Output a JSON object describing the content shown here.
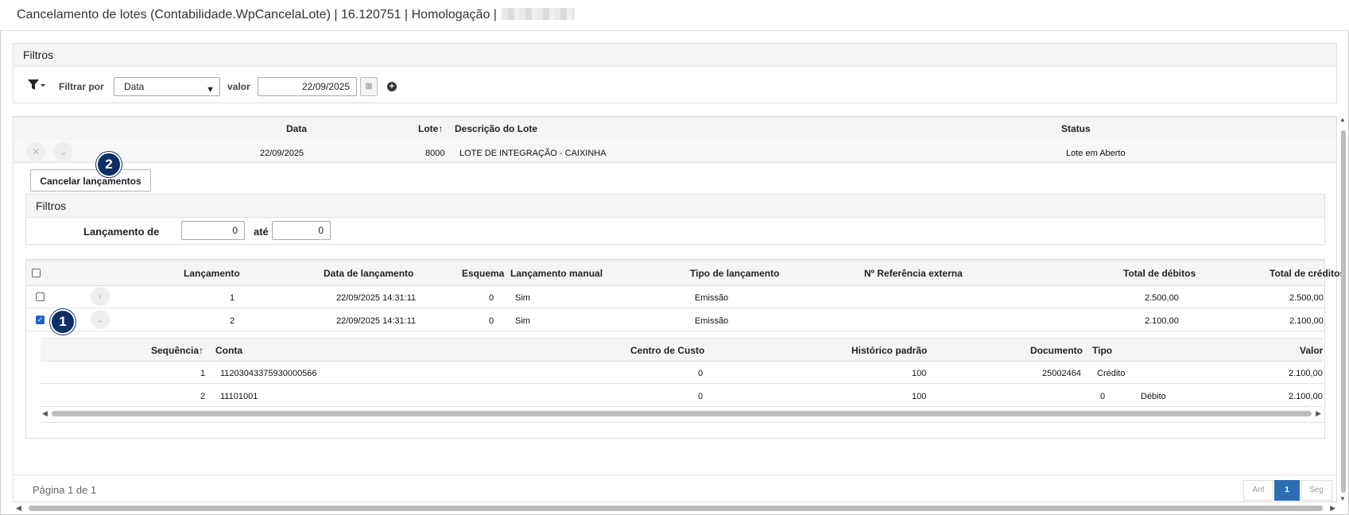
{
  "window": {
    "title": "Cancelamento de lotes (Contabilidade.WpCancelaLote) | 16.120751 | Homologação |"
  },
  "filters": {
    "header": "Filtros",
    "filter_by_label": "Filtrar por",
    "filter_field": "Data",
    "value_label": "valor",
    "value": "22/09/2025"
  },
  "lots_grid": {
    "columns": [
      "Data",
      "Lote",
      "Descrição do Lote",
      "Status"
    ],
    "sort_icon": "↑",
    "row": {
      "data": "22/09/2025",
      "lote": "8000",
      "descricao": "LOTE DE INTEGRAÇÃO - CAIXINHA",
      "status": "Lote em Aberto"
    }
  },
  "actions": {
    "cancel_button": "Cancelar lançamentos",
    "badge_2": "2",
    "badge_1": "1"
  },
  "sub_filters": {
    "header": "Filtros",
    "from_label": "Lançamento de",
    "from_value": "0",
    "to_label": "até",
    "to_value": "0"
  },
  "entries_grid": {
    "columns": [
      "Lançamento",
      "Data de lançamento",
      "Esquema",
      "Lançamento manual",
      "Tipo de lançamento",
      "Nº Referência externa",
      "Total de débitos",
      "Total de créditos"
    ],
    "rows": [
      {
        "lancamento": "1",
        "data": "22/09/2025 14:31:11",
        "esquema": "0",
        "manual": "Sim",
        "tipo": "Emissão",
        "ref": "",
        "debitos": "2.500,00",
        "creditos": "2.500,00",
        "checked": false
      },
      {
        "lancamento": "2",
        "data": "22/09/2025 14:31:11",
        "esquema": "0",
        "manual": "Sim",
        "tipo": "Emissão",
        "ref": "",
        "debitos": "2.100,00",
        "creditos": "2.100,00",
        "checked": true
      }
    ]
  },
  "detail_grid": {
    "columns": [
      "Sequência",
      "Conta",
      "Centro de Custo",
      "Histórico padrão",
      "Documento",
      "Tipo",
      "Valor"
    ],
    "rows": [
      {
        "seq": "1",
        "conta": "11203043375930000566",
        "centro": "0",
        "historico": "100",
        "documento": "25002464",
        "tipo": "Crédito",
        "valor": "2.100,00"
      },
      {
        "seq": "2",
        "conta": "11101001",
        "centro": "0",
        "historico": "100",
        "documento": "0",
        "tipo": "Débito",
        "valor": "2.100,00"
      }
    ]
  },
  "pagination": {
    "label": "Página 1 de 1",
    "prev": "Ant",
    "current": "1",
    "next": "Seg"
  }
}
